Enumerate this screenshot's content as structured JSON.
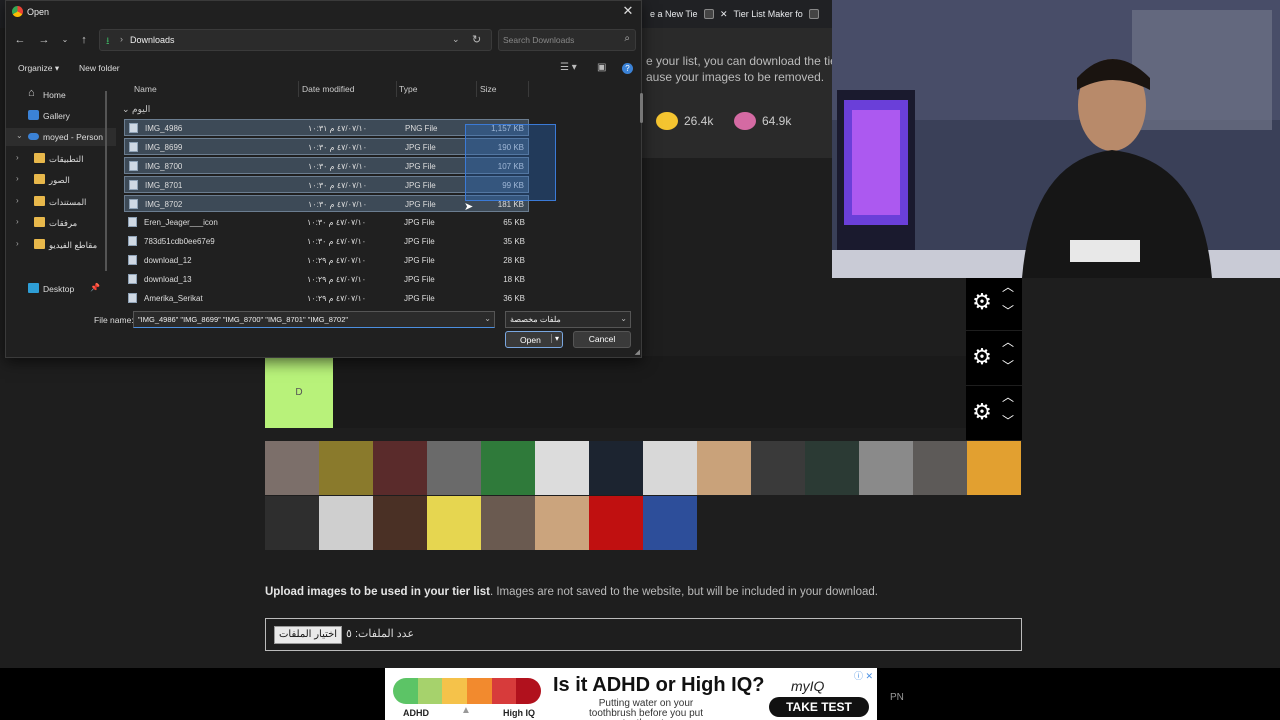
{
  "browser": {
    "tabs": [
      {
        "label": "e a New Tie",
        "close": "✕"
      },
      {
        "label": "Tier List Maker fo",
        "close": "✕"
      }
    ]
  },
  "page": {
    "partial_line_1": "e your list, you can download the tie",
    "partial_line_2": "ause your images to be removed.",
    "reactions": [
      {
        "count": "26.4k",
        "icon": "raised-hands-icon",
        "color": "#f4c430"
      },
      {
        "count": "64.9k",
        "icon": "poop-icon",
        "color": "#d46aa3"
      }
    ],
    "tier_d_label": "D",
    "thumb_colors": [
      "#7c6f6a",
      "#8a7a2c",
      "#5a2b2b",
      "#6a6a6a",
      "#2f7a3a",
      "#dcdcdc",
      "#1c2430",
      "#d8d8d8",
      "#c9a27a",
      "#3a3a3a",
      "#2b3a34",
      "#8a8a8a",
      "#5d5a58",
      "#e2a030",
      "#2e2e2e",
      "#cfcfcf",
      "#4a3025",
      "#e6d650",
      "#6a5a50",
      "#cba47d",
      "#c01010",
      "#2d4e9a"
    ],
    "upload_bold": "Upload images to be used in your tier list",
    "upload_rest": ". Images are not saved to the website, but will be included in your download.",
    "file_button": "اختيار الملفات",
    "file_count": "عدد الملفات: ٥"
  },
  "ad": {
    "headline": "Is it ADHD or High IQ?",
    "sub": "Putting water on your toothbrush before you put toothpaste",
    "brand": "myIQ",
    "cta": "TAKE TEST",
    "label_left": "ADHD",
    "label_right": "High IQ",
    "adchoice": "ⓘ ✕",
    "bar_colors": [
      "#5cc466",
      "#a6d26c",
      "#f5c24a",
      "#f28a2e",
      "#d73b3b",
      "#b1111d"
    ]
  },
  "pn": "PN",
  "dialog": {
    "title": "Open",
    "close": "✕",
    "path": "Downloads",
    "search_placeholder": "Search Downloads",
    "organize": "Organize ▾",
    "new_folder": "New folder",
    "help": "?",
    "sidebar": [
      {
        "label": "Home",
        "icon": "home-icon",
        "chevron": ""
      },
      {
        "label": "Gallery",
        "icon": "gallery-icon",
        "chevron": ""
      },
      {
        "label": "moyed - Person",
        "icon": "cloud-icon",
        "chevron": "⌄"
      },
      {
        "label": "التطبيقات",
        "icon": "folder-icon",
        "chevron": "›"
      },
      {
        "label": "الصور",
        "icon": "folder-icon",
        "chevron": "›"
      },
      {
        "label": "المستندات",
        "icon": "folder-icon",
        "chevron": "›"
      },
      {
        "label": "مرفقات",
        "icon": "folder-icon",
        "chevron": "›"
      },
      {
        "label": "مقاطع الفيديو",
        "icon": "folder-icon",
        "chevron": "›"
      },
      {
        "label": "Desktop",
        "icon": "desktop-icon",
        "chevron": ""
      }
    ],
    "columns": {
      "name": "Name",
      "date": "Date modified",
      "type": "Type",
      "size": "Size"
    },
    "group": "اليوم",
    "files": [
      {
        "name": "IMG_4986",
        "date": "٤٧/٠٧/١٠ م ١٠:٣١",
        "type": "PNG File",
        "size": "1,157 KB",
        "selected": true
      },
      {
        "name": "IMG_8699",
        "date": "٤٧/٠٧/١٠ م ١٠:٣٠",
        "type": "JPG File",
        "size": "190 KB",
        "selected": true
      },
      {
        "name": "IMG_8700",
        "date": "٤٧/٠٧/١٠ م ١٠:٣٠",
        "type": "JPG File",
        "size": "107 KB",
        "selected": true
      },
      {
        "name": "IMG_8701",
        "date": "٤٧/٠٧/١٠ م ١٠:٣٠",
        "type": "JPG File",
        "size": "99 KB",
        "selected": true
      },
      {
        "name": "IMG_8702",
        "date": "٤٧/٠٧/١٠ م ١٠:٣٠",
        "type": "JPG File",
        "size": "181 KB",
        "selected": true
      },
      {
        "name": "Eren_Jeager___icon",
        "date": "٤٧/٠٧/١٠ م ١٠:٣٠",
        "type": "JPG File",
        "size": "65 KB",
        "selected": false
      },
      {
        "name": "783d51cdb0ee67e9",
        "date": "٤٧/٠٧/١٠ م ١٠:٣٠",
        "type": "JPG File",
        "size": "35 KB",
        "selected": false
      },
      {
        "name": "download_12",
        "date": "٤٧/٠٧/١٠ م ١٠:٢٩",
        "type": "JPG File",
        "size": "28 KB",
        "selected": false
      },
      {
        "name": "download_13",
        "date": "٤٧/٠٧/١٠ م ١٠:٢٩",
        "type": "JPG File",
        "size": "18 KB",
        "selected": false
      },
      {
        "name": "Amerika_Serikat",
        "date": "٤٧/٠٧/١٠ م ١٠:٢٩",
        "type": "JPG File",
        "size": "36 KB",
        "selected": false
      }
    ],
    "file_name_label": "File name:",
    "file_name_value": "\"IMG_4986\" \"IMG_8699\" \"IMG_8700\" \"IMG_8701\" \"IMG_8702\"",
    "file_type_value": "ملفات مخصصة",
    "open_label": "Open",
    "cancel_label": "Cancel"
  }
}
